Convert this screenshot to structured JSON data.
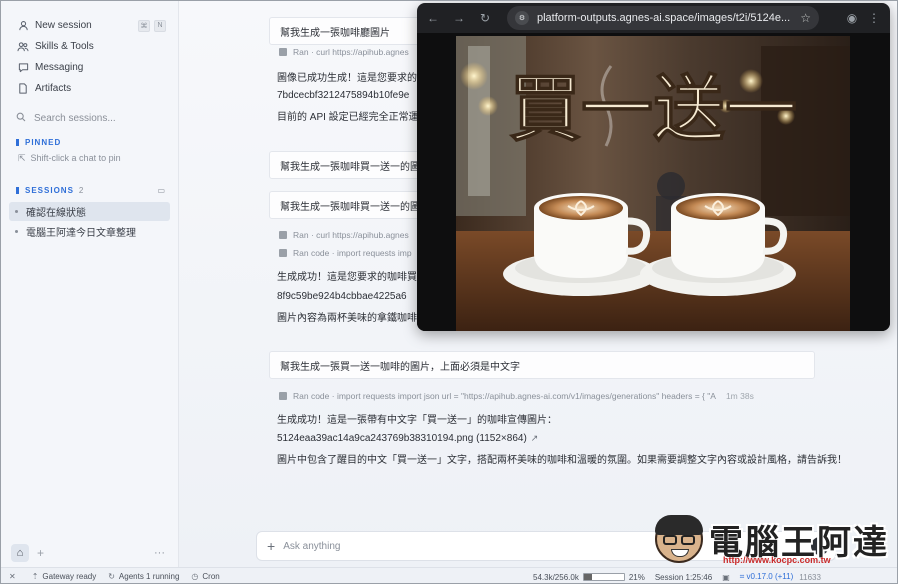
{
  "sidebar": {
    "nav": [
      {
        "label": "New session",
        "shortcut": [
          "⌘",
          "N"
        ]
      },
      {
        "label": "Skills & Tools"
      },
      {
        "label": "Messaging"
      },
      {
        "label": "Artifacts"
      }
    ],
    "search_placeholder": "Search sessions...",
    "pinned": {
      "title": "PINNED",
      "hint": "Shift-click a chat to pin"
    },
    "sessions": {
      "title": "SESSIONS",
      "count": "2",
      "items": [
        {
          "label": "確認在線狀態",
          "active": true
        },
        {
          "label": "電腦王阿達今日文章整理",
          "active": false
        }
      ]
    }
  },
  "chat": {
    "bubble1": "幫我生成一張咖啡廳圖片",
    "tool1": "Ran · curl https://apihub.agnes",
    "reply1_line1": "圖像已成功生成！這是您要求的咖",
    "reply1_line2": "7bdcecbf3212475894b10fe9e",
    "reply1_line3": "目前的 API 設定已經完全正常運作",
    "bubble2": "幫我生成一張咖啡買一送一的圖片",
    "bubble3": "幫我生成一張咖啡買一送一的圖片",
    "tool2": "Ran · curl https://apihub.agnes",
    "tool3": "Ran code · import requests imp",
    "reply2_line1": "生成成功！這是您要求的咖啡買一",
    "reply2_line2": "8f9c59be924b4cbbae4225a6",
    "reply2_line3": "圖片內容為兩杯美味的拿鐵咖啡放",
    "bubble4": "幫我生成一張買一送一咖啡的圖片，上面必須是中文字",
    "tool4": "Ran code · import requests import json url = \"https://apihub.agnes-ai.com/v1/images/generations\" headers = { \"A",
    "tool4_duration": "1m 38s",
    "reply3_line1": "生成成功！這是一張帶有中文字「買一送一」的咖啡宣傳圖片：",
    "reply3_file": "5124eaa39ac14a9ca243769b38310194.png (1152×864)",
    "reply3_line3": "圖片中包含了醒目的中文「買一送一」文字，搭配兩杯美味的咖啡和溫暖的氛圍。如果需要調整文字內容或設計風格，請告訴我！"
  },
  "composer": {
    "placeholder": "Ask anything"
  },
  "watermark": {
    "title": "電腦王阿達",
    "url": "http://www.kocpc.com.tw"
  },
  "statusbar": {
    "gateway": "Gateway ready",
    "agents": "Agents 1 running",
    "cron": "Cron",
    "tokens": "54.3k/256.0k",
    "context_pct_label": "21%",
    "context_fraction": 0.21,
    "session": "Session 1:25:46",
    "version": "v0.17.0 (+11)",
    "build": "11633"
  },
  "browser": {
    "url": "platform-outputs.agnes-ai.space/images/t2i/5124e...",
    "image_text": "買一送一"
  },
  "colors": {
    "accent": "#2f6fd8",
    "browser_chrome": "#202124"
  }
}
